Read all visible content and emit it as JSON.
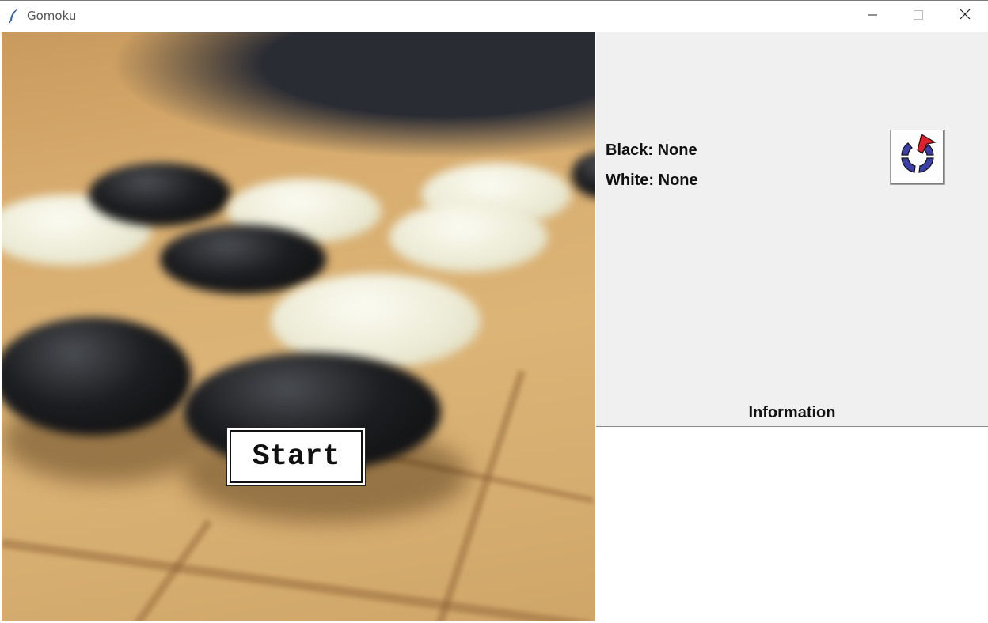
{
  "window": {
    "title": "Gomoku",
    "icon": "feather-icon",
    "controls": [
      "minimize-icon",
      "maximize-icon",
      "close-icon"
    ]
  },
  "board": {
    "start_label": "Start"
  },
  "players": {
    "black_label": "Black: None",
    "white_label": "White: None"
  },
  "restart": {
    "icon": "restart-icon"
  },
  "information": {
    "title": "Information",
    "text": ""
  },
  "colors": {
    "panel_bg": "#f0f0f0",
    "restart_arrow": "#e0202a",
    "restart_ring": "#3d3fa8"
  }
}
